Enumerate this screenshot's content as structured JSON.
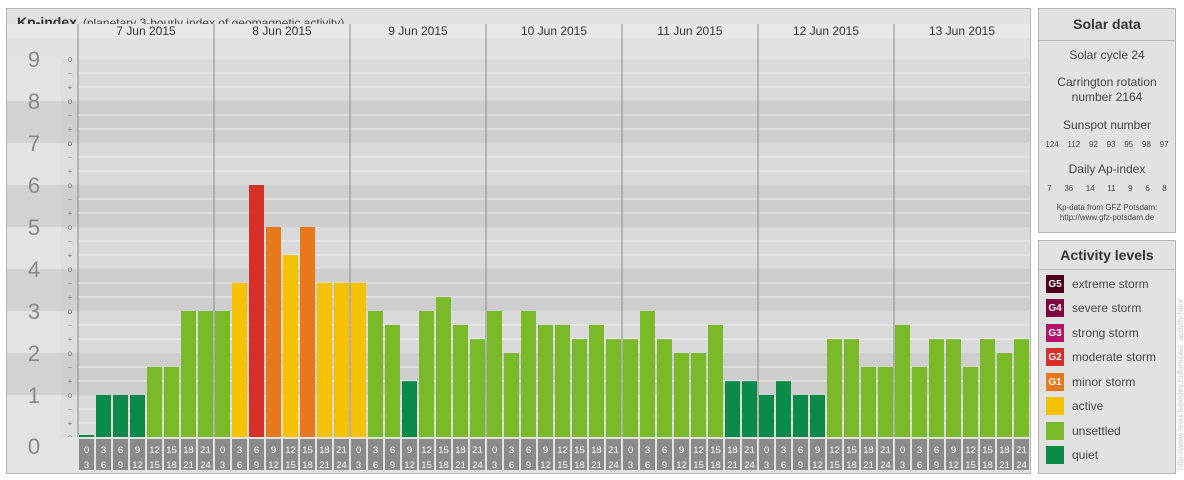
{
  "header": {
    "title": "Kp-index",
    "subtitle": "(planetary 3-hourly index of geomagnetic activity)"
  },
  "solar": {
    "title": "Solar data",
    "cycle": "Solar cycle 24",
    "carrington_1": "Carrington rotation",
    "carrington_2": "number 2164",
    "sunspot_label": "Sunspot number",
    "sunspot_values": [
      "124",
      "112",
      "92",
      "93",
      "95",
      "98",
      "97"
    ],
    "ap_label": "Daily Ap-index",
    "ap_values": [
      "7",
      "36",
      "14",
      "11",
      "9",
      "6",
      "8"
    ],
    "source_1": "Kp-data from GFZ Potsdam:",
    "source_2": "http://www.gfz-potsdam.de"
  },
  "activity": {
    "title": "Activity levels",
    "levels": [
      {
        "code": "G5",
        "label": "extreme storm",
        "color": "#4d0019"
      },
      {
        "code": "G4",
        "label": "severe storm",
        "color": "#800040"
      },
      {
        "code": "G3",
        "label": "strong storm",
        "color": "#b3156b"
      },
      {
        "code": "G2",
        "label": "moderate storm",
        "color": "#d73027"
      },
      {
        "code": "G1",
        "label": "minor storm",
        "color": "#e8781a"
      },
      {
        "code": "",
        "label": "active",
        "color": "#f5c200"
      },
      {
        "code": "",
        "label": "unsettled",
        "color": "#7aba28"
      },
      {
        "code": "",
        "label": "quiet",
        "color": "#0c8a4a"
      }
    ]
  },
  "watermark": "http://www.tesis.lebedev.ru/forecast_activity.html",
  "chart_data": {
    "type": "bar",
    "title": "Kp-index",
    "subtitle": "(planetary 3-hourly index of geomagnetic activity)",
    "ylim": [
      0,
      9
    ],
    "y_ticks": [
      "0",
      "1",
      "2",
      "3",
      "4",
      "5",
      "6",
      "7",
      "8",
      "9"
    ],
    "sub_ticks": [
      "+",
      "o",
      "−"
    ],
    "days": [
      "7 Jun 2015",
      "8 Jun 2015",
      "9 Jun 2015",
      "10 Jun 2015",
      "11 Jun 2015",
      "12 Jun 2015",
      "13 Jun 2015"
    ],
    "intervals": [
      [
        "0",
        "3"
      ],
      [
        "3",
        "6"
      ],
      [
        "6",
        "9"
      ],
      [
        "9",
        "12"
      ],
      [
        "12",
        "15"
      ],
      [
        "15",
        "18"
      ],
      [
        "18",
        "21"
      ],
      [
        "21",
        "24"
      ]
    ],
    "values": [
      0.0,
      1.0,
      1.0,
      1.0,
      1.67,
      1.67,
      3.0,
      3.0,
      3.0,
      3.67,
      6.0,
      5.0,
      4.33,
      5.0,
      3.67,
      3.67,
      3.67,
      3.0,
      2.67,
      1.33,
      3.0,
      3.33,
      2.67,
      2.33,
      3.0,
      2.0,
      3.0,
      2.67,
      2.67,
      2.33,
      2.67,
      2.33,
      2.33,
      3.0,
      2.33,
      2.0,
      2.0,
      2.67,
      1.33,
      1.33,
      1.0,
      1.33,
      1.0,
      1.0,
      2.33,
      2.33,
      1.67,
      1.67,
      2.67,
      1.67,
      2.33,
      2.33,
      1.67,
      2.33,
      2.0,
      2.33
    ],
    "levels": [
      "quiet",
      "quiet",
      "quiet",
      "quiet",
      "unsettled",
      "unsettled",
      "unsettled",
      "unsettled",
      "unsettled",
      "active",
      "moderate storm",
      "minor storm",
      "active",
      "minor storm",
      "active",
      "active",
      "active",
      "unsettled",
      "unsettled",
      "quiet",
      "unsettled",
      "unsettled",
      "unsettled",
      "unsettled",
      "unsettled",
      "unsettled",
      "unsettled",
      "unsettled",
      "unsettled",
      "unsettled",
      "unsettled",
      "unsettled",
      "unsettled",
      "unsettled",
      "unsettled",
      "unsettled",
      "unsettled",
      "unsettled",
      "quiet",
      "quiet",
      "quiet",
      "quiet",
      "quiet",
      "quiet",
      "unsettled",
      "unsettled",
      "unsettled",
      "unsettled",
      "unsettled",
      "unsettled",
      "unsettled",
      "unsettled",
      "unsettled",
      "unsettled",
      "unsettled",
      "unsettled"
    ],
    "grid": true,
    "legend": "right"
  }
}
